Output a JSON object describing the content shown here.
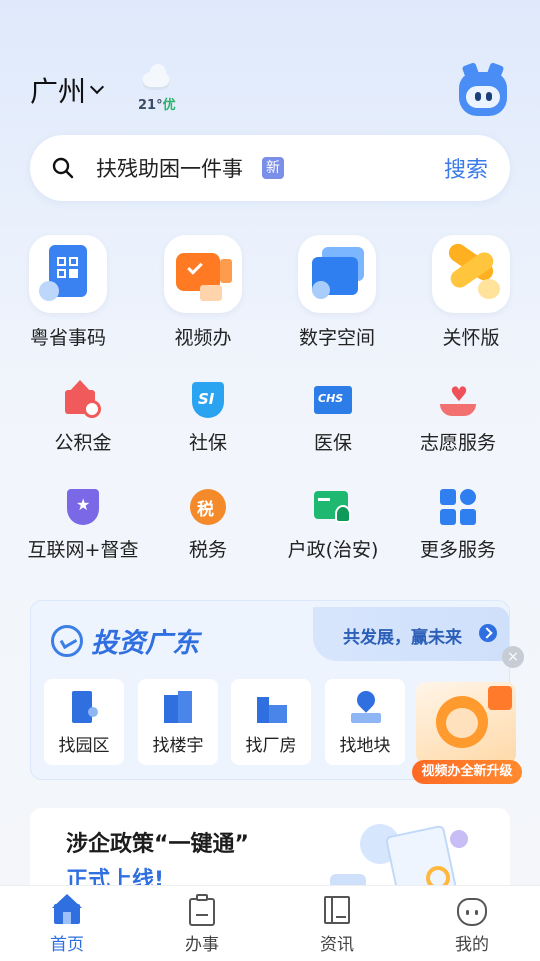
{
  "header": {
    "city": "广州",
    "temperature": "21°",
    "air_quality": "优"
  },
  "search": {
    "placeholder": "扶残助困一件事",
    "badge": "新",
    "button": "搜索"
  },
  "top_services": [
    {
      "label": "粤省事码",
      "icon": "qr-code-icon"
    },
    {
      "label": "视频办",
      "icon": "video-service-icon"
    },
    {
      "label": "数字空间",
      "icon": "digital-space-icon"
    },
    {
      "label": "关怀版",
      "icon": "care-scarf-icon"
    }
  ],
  "services": [
    {
      "label": "公积金",
      "icon": "housing-fund-icon"
    },
    {
      "label": "社保",
      "icon": "social-security-icon"
    },
    {
      "label": "医保",
      "icon": "medical-insurance-icon"
    },
    {
      "label": "志愿服务",
      "icon": "volunteer-heart-icon"
    },
    {
      "label": "互联网+督查",
      "icon": "supervision-badge-icon"
    },
    {
      "label": "税务",
      "icon": "tax-icon"
    },
    {
      "label": "户政(治安)",
      "icon": "household-registration-icon"
    },
    {
      "label": "更多服务",
      "icon": "more-services-icon"
    }
  ],
  "invest": {
    "title": "投资广东",
    "slogan": "共发展，赢未来",
    "tiles": [
      {
        "label": "找园区",
        "icon": "park-icon"
      },
      {
        "label": "找楼宇",
        "icon": "building-icon"
      },
      {
        "label": "找厂房",
        "icon": "factory-icon"
      },
      {
        "label": "找地块",
        "icon": "land-plot-icon"
      }
    ]
  },
  "promo": {
    "label": "视频办全新升级",
    "close": "×"
  },
  "policy": {
    "line1": "涉企政策“一键通”",
    "line2": "正式上线!"
  },
  "tabbar": [
    {
      "label": "首页",
      "icon": "home-icon",
      "active": true
    },
    {
      "label": "办事",
      "icon": "clipboard-icon",
      "active": false
    },
    {
      "label": "资讯",
      "icon": "news-book-icon",
      "active": false
    },
    {
      "label": "我的",
      "icon": "profile-icon",
      "active": false
    }
  ],
  "colors": {
    "accent": "#2f6fe0",
    "promo": "#ff6a24",
    "air_quality": "#2cb36b"
  }
}
